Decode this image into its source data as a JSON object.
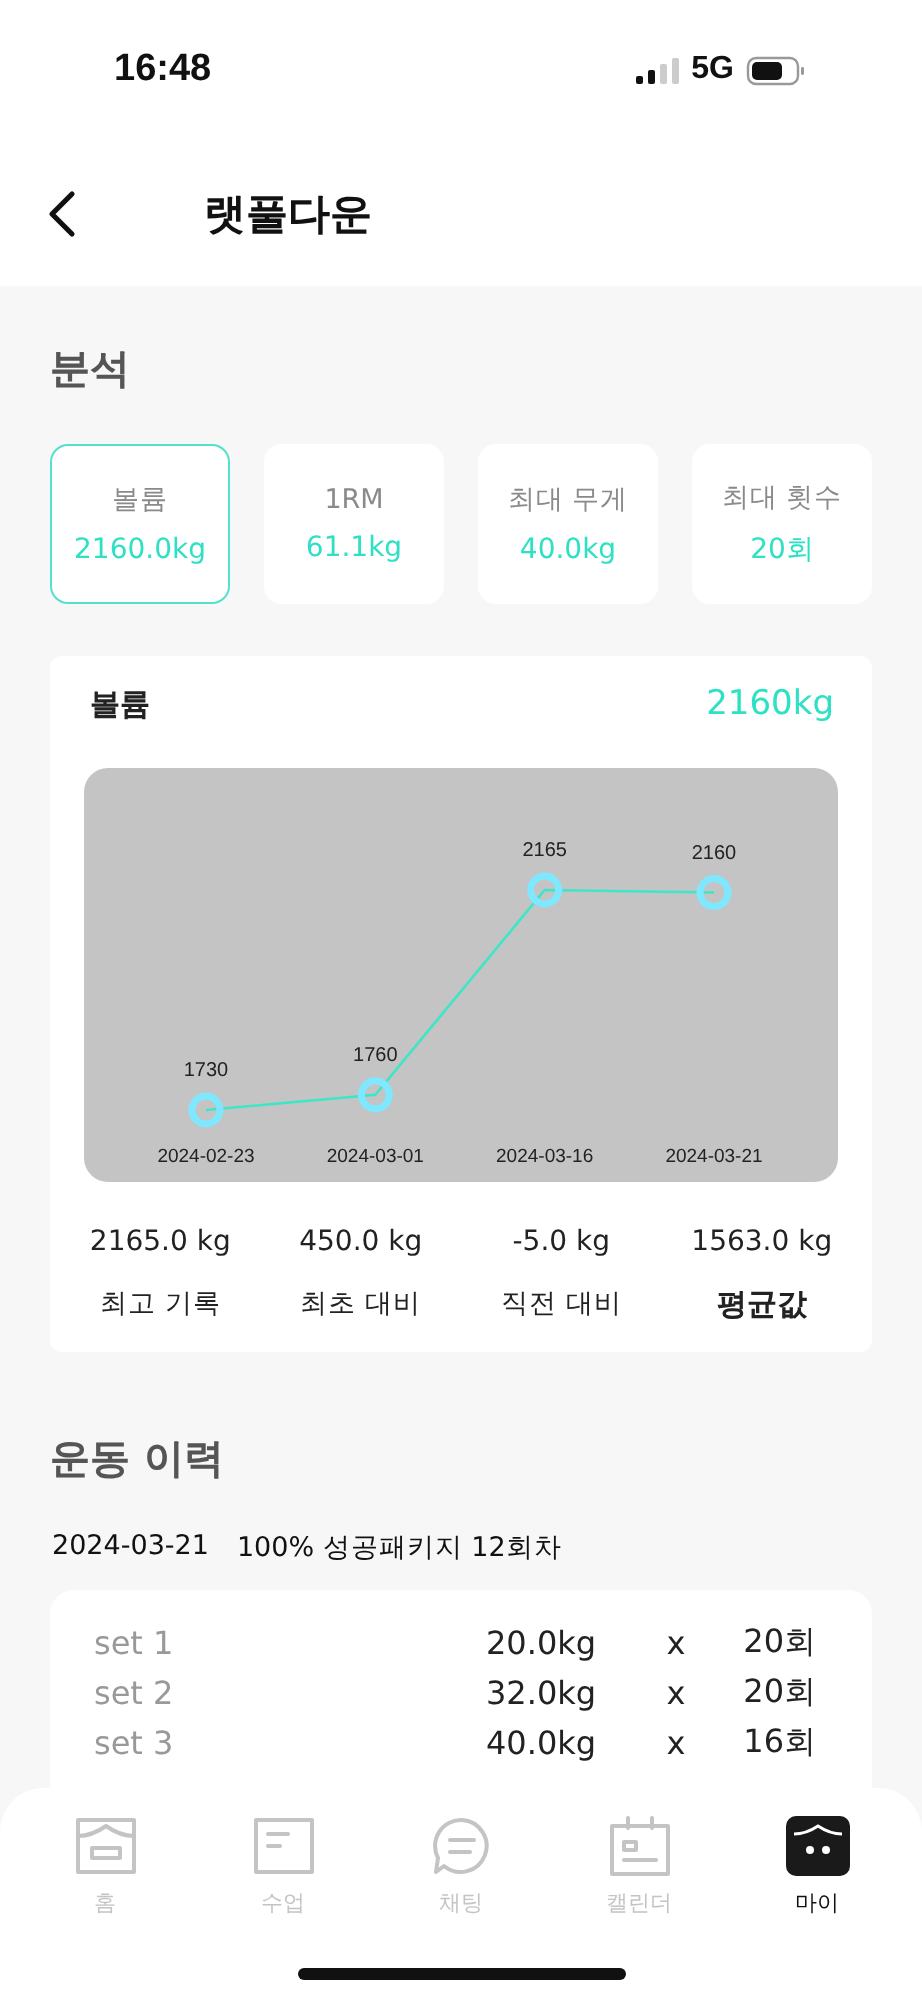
{
  "status_bar": {
    "time": "16:48",
    "network": "5G"
  },
  "header": {
    "title": "랫풀다운"
  },
  "analysis": {
    "title": "분석",
    "metrics": [
      {
        "label": "볼륨",
        "value": "2160.0kg",
        "selected": true
      },
      {
        "label": "1RM",
        "value": "61.1kg",
        "selected": false
      },
      {
        "label": "최대 무게",
        "value": "40.0kg",
        "selected": false
      },
      {
        "label": "최대 횟수",
        "value": "20회",
        "selected": false
      }
    ],
    "chart_card": {
      "title": "볼륨",
      "total": "2160kg",
      "chart_data": {
        "type": "line",
        "categories": [
          "2024-02-23",
          "2024-03-01",
          "2024-03-16",
          "2024-03-21"
        ],
        "series": [
          {
            "color": "#3ee6c8",
            "marker": "circle",
            "values": [
              1730,
              1760,
              2165,
              2160
            ]
          }
        ],
        "data_labels": true
      },
      "stats": [
        {
          "value": "2165.0 kg",
          "label": "최고 기록"
        },
        {
          "value": "450.0 kg",
          "label": "최초 대비"
        },
        {
          "value": "-5.0 kg",
          "label": "직전 대비"
        },
        {
          "value": "1563.0 kg",
          "label": "평균값"
        }
      ]
    }
  },
  "history": {
    "title": "운동 이력",
    "records": [
      {
        "date": "2024-03-21",
        "package": "100% 성공패키지 12회차",
        "sets": [
          {
            "name": "set 1",
            "weight": "20.0kg",
            "times": "x",
            "reps": "20회"
          },
          {
            "name": "set 2",
            "weight": "32.0kg",
            "times": "x",
            "reps": "20회"
          },
          {
            "name": "set 3",
            "weight": "40.0kg",
            "times": "x",
            "reps": "16회"
          }
        ]
      }
    ]
  },
  "tab_bar": [
    {
      "label": "홈",
      "kind": "home",
      "selected": false
    },
    {
      "label": "수업",
      "kind": "class",
      "selected": false
    },
    {
      "label": "채팅",
      "kind": "chat",
      "selected": false
    },
    {
      "label": "캘린더",
      "kind": "calendar",
      "selected": false
    },
    {
      "label": "마이",
      "kind": "my",
      "selected": true
    }
  ]
}
